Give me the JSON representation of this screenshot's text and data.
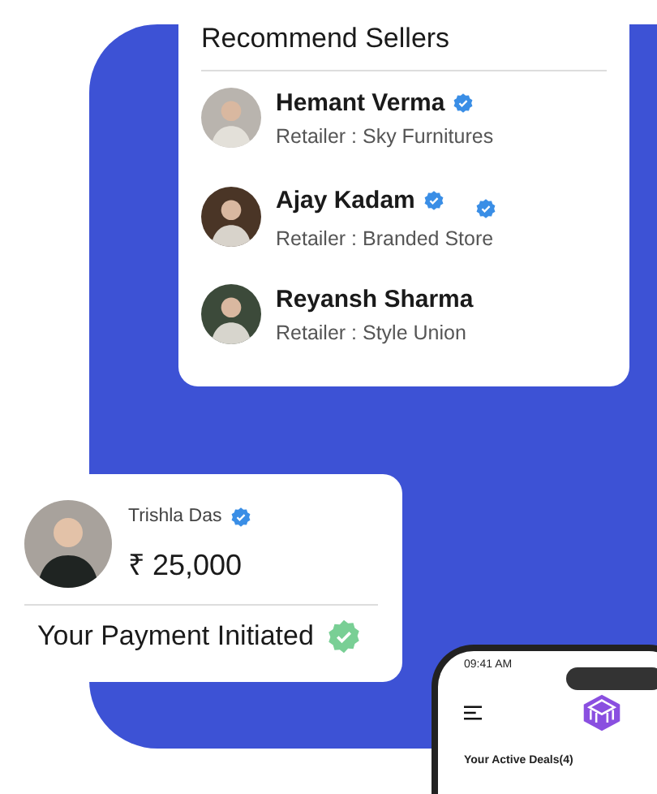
{
  "sellers_card": {
    "title": "Recommend Sellers",
    "sellers": [
      {
        "name": "Hemant Verma",
        "verified": true,
        "extra_badge": false,
        "role": "Retailer : Sky Furnitures"
      },
      {
        "name": "Ajay Kadam",
        "verified": true,
        "extra_badge": true,
        "role": "Retailer : Branded Store"
      },
      {
        "name": "Reyansh Sharma",
        "verified": false,
        "extra_badge": false,
        "role": "Retailer : Style Union"
      }
    ]
  },
  "payment_card": {
    "name": "Trishla Das",
    "verified": true,
    "amount": "₹ 25,000",
    "status": "Your Payment Initiated"
  },
  "phone": {
    "time": "09:41 AM",
    "section": "Your Active Deals(4)"
  }
}
